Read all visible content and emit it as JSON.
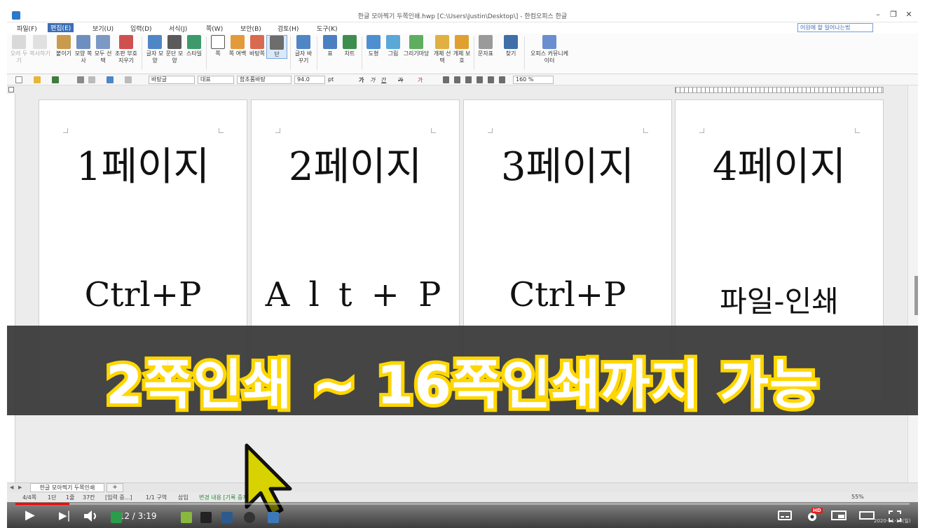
{
  "window": {
    "title": "한글 모아찍기 두쪽인쇄.hwp [C:\\Users\\Justin\\Desktop\\] - 한컴오피스 한글",
    "minimize": "–",
    "restore": "❐",
    "close": "✕"
  },
  "menu": {
    "items": [
      "파일(F)",
      "편집(E)",
      "보기(U)",
      "입력(D)",
      "서식(J)",
      "쪽(W)",
      "보안(B)",
      "검토(H)",
      "도구(K)"
    ],
    "help_placeholder": "어원에 할 일어나는법",
    "active_index": 1
  },
  "ribbon": {
    "cut": "오려 두기",
    "copy": "복사하기",
    "paste": "붙이기",
    "format_copy": "모양 복사",
    "select_all": "모두 선택",
    "clear_format": "조판 부호 지우기",
    "char_shape": "글자 모양",
    "para_shape": "문단 모양",
    "style": "스타일",
    "page": "쪽",
    "page_margin": "쪽 여백",
    "background": "바탕쪽",
    "columns": "단",
    "change_char": "글자 바꾸기",
    "table": "표",
    "chart": "차트",
    "shape": "도형",
    "picture": "그림",
    "gallery": "그리기마당",
    "object_select": "개체 선택",
    "object_protect": "개체 보호",
    "symbol": "문자표",
    "find": "찾기",
    "office_comm": "오피스 커뮤니케이터"
  },
  "format_bar": {
    "style_name": "바탕글",
    "lang": "대표",
    "font_name": "함초롬바탕",
    "font_size": "94.0",
    "unit": "pt",
    "bold": "가",
    "italic": "가",
    "underline": "간",
    "strike": "가",
    "color": "가",
    "line_spacing": "160",
    "line_unit": "%"
  },
  "pages": [
    {
      "heading": "1페이지",
      "shortcut": "Ctrl+P"
    },
    {
      "heading": "2페이지",
      "shortcut": "A l t + P"
    },
    {
      "heading": "3페이지",
      "shortcut": "Ctrl+P"
    },
    {
      "heading": "4페이지",
      "shortcut": "파일-인쇄"
    }
  ],
  "caption": "2쪽인쇄 ~ 16쪽인쇄까지 가능",
  "sheet": {
    "tab_label": "한글 모아찍기 두쪽인쇄",
    "add": "+"
  },
  "status": {
    "page": "4/4쪽",
    "column": "1단",
    "line": "1줄",
    "col": "37칸",
    "mode": "[입력 중...]",
    "section": "1/1 구역",
    "insert": "삽입",
    "changes": "변경 내용 [기록 중지]",
    "zoom": "55%"
  },
  "player": {
    "time": "0:12 / 3:19",
    "progress": 0.06,
    "hd": "HD",
    "taskbar_date": "2020-11-18(일)",
    "taskbar_time": "오후 5:41"
  },
  "colors": {
    "caption_fill": "#ffffff",
    "caption_stroke": "#ffd700",
    "caption_band": "#373737",
    "progress": "#ff0000",
    "menu_active": "#3b6fb6"
  }
}
